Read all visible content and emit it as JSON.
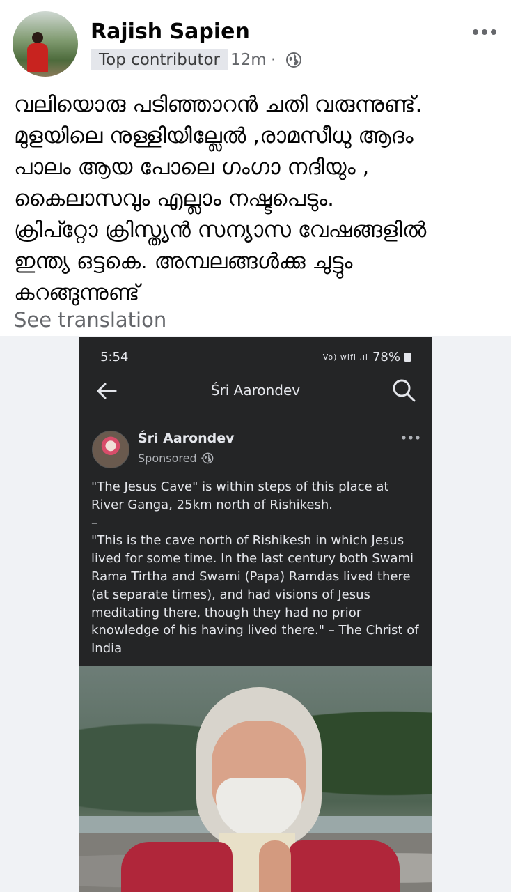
{
  "post": {
    "author": "Rajish Sapien",
    "badge": "Top contributor",
    "time": "12m",
    "separator": "·",
    "audience_icon": "globe-icon",
    "more_icon": "more-horizontal-icon",
    "text": "വലിയൊരു പടിഞ്ഞാറൻ ചതി വരുന്നുണ്ട്.\nമുളയിലെ നുള്ളിയില്ലേൽ ,രാമസീധു ആദം\nപാലം ആയ പോലെ ഗംഗാ നദിയും ,\nകൈലാസവും എല്ലാം നഷ്ടപെടും.\nക്രിപ്റ്റോ ക്രിസ്ത്യൻ സന്യാസ വേഷങ്ങളിൽ\nഇന്ത്യ ഒട്ടകെ.  അമ്പലങ്ങൾക്കു ചുട്ടും\nകറങ്ങുന്നുണ്ട്",
    "see_translation": "See translation"
  },
  "screenshot": {
    "status_time": "5:54",
    "status_icons": "Vo) wifi .ıl",
    "battery": "78%",
    "page_title": "Śri Aarondev",
    "back_icon": "arrow-left-icon",
    "search_icon": "search-icon",
    "ad": {
      "name": "Śri Aarondev",
      "sponsored": "Sponsored ·",
      "text": "\"The Jesus Cave\" is within steps of this place at\nRiver Ganga, 25km north of Rishikesh.\n–\n\"This is the cave north of Rishikesh in which Jesus\nlived for some time. In the last century both Swami\nRama Tirtha and Swami (Papa) Ramdas lived there\n(at separate times), and had visions of Jesus\nmeditating there, though they had no prior\nknowledge of his having lived there.\" – The Christ of\nIndia"
    }
  },
  "colors": {
    "text_primary": "#050505",
    "text_secondary": "#65676b",
    "badge_bg": "#e4e6eb",
    "dark_bg": "#242526",
    "dark_text": "#e4e6eb"
  }
}
